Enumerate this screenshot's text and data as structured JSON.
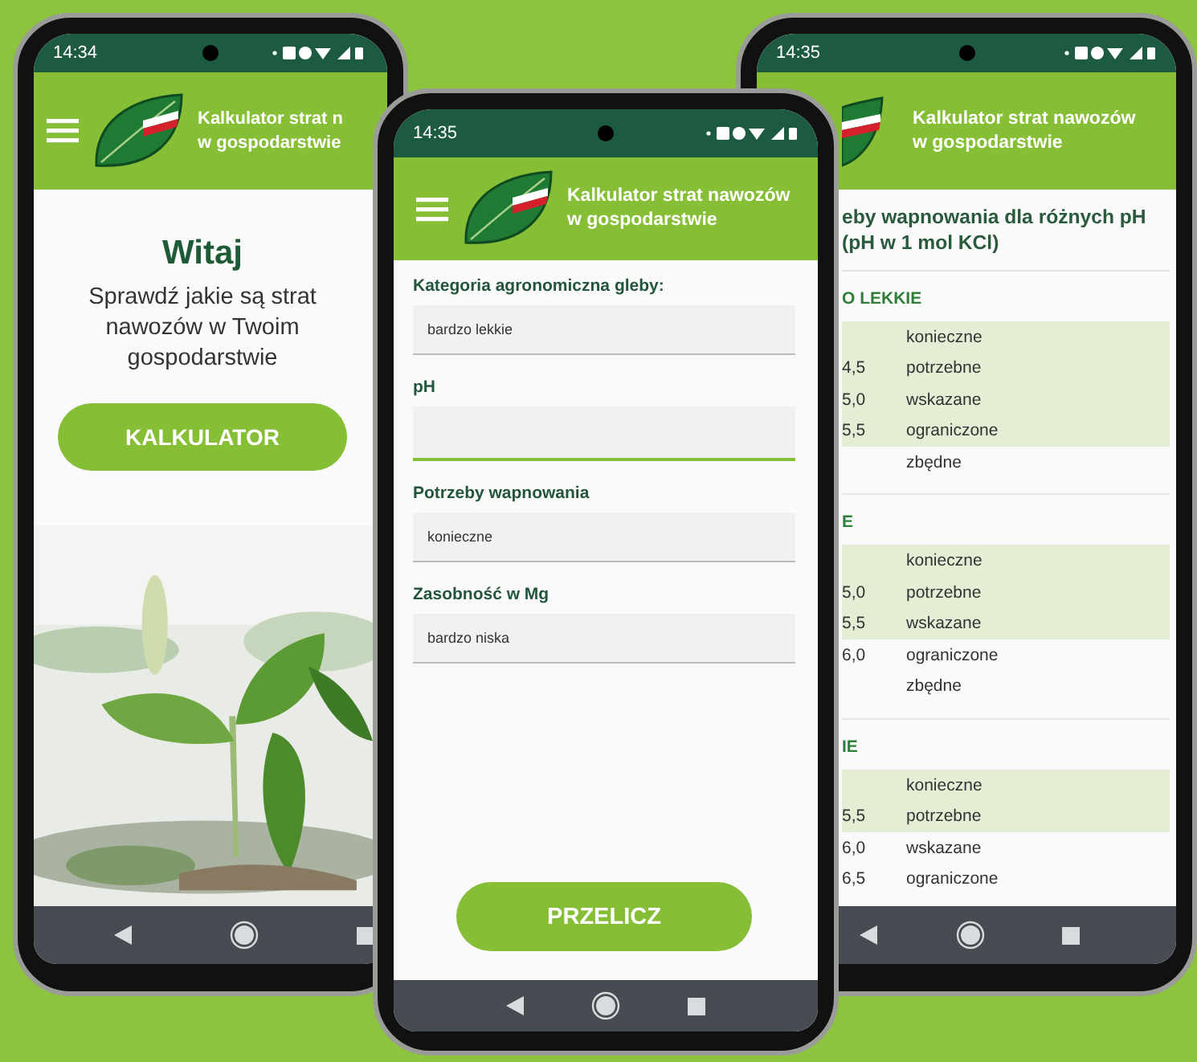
{
  "phones": [
    {
      "kind": "welcome",
      "status_time": "14:34",
      "app_title": [
        "Kalkulator strat n",
        "w gospodarstwie"
      ],
      "heading": "Witaj",
      "message_lines": [
        "Sprawdź jakie są strat",
        "nawozów w Twoim",
        "gospodarstwie"
      ],
      "button": "KALKULATOR"
    },
    {
      "kind": "form",
      "status_time": "14:35",
      "app_title": [
        "Kalkulator strat nawozów",
        "w gospodarstwie"
      ],
      "fields": [
        {
          "label": "Kategoria agronomiczna gleby:",
          "value": "bardzo lekkie",
          "focused": false
        },
        {
          "label": "pH",
          "focused": true
        },
        {
          "label": "Potrzeby wapnowania",
          "value": "konieczne",
          "focused": false
        },
        {
          "label": "Zasobność w Mg",
          "value": "bardzo niska",
          "focused": false
        }
      ],
      "button": "PRZELICZ"
    },
    {
      "kind": "table",
      "status_time": "14:35",
      "app_title": [
        "Kalkulator strat nawozów",
        "w gospodarstwie"
      ],
      "title_lines": [
        "eby wapnowania dla różnych pH",
        "(pH w 1 mol KCl)"
      ],
      "sections": [
        {
          "heading": "O LEKKIE",
          "rows": [
            {
              "need": "konieczne",
              "highlighted": true
            },
            {
              "ph": "4,5",
              "need": "potrzebne",
              "highlighted": true
            },
            {
              "ph": "5,0",
              "need": "wskazane",
              "highlighted": true
            },
            {
              "ph": "5,5",
              "need": "ograniczone",
              "highlighted": true
            },
            {
              "need": "zbędne",
              "highlighted": false
            }
          ]
        },
        {
          "heading": "E",
          "rows": [
            {
              "need": "konieczne",
              "highlighted": true
            },
            {
              "ph": "5,0",
              "need": "potrzebne",
              "highlighted": true
            },
            {
              "ph": "5,5",
              "need": "wskazane",
              "highlighted": true
            },
            {
              "ph": "6,0",
              "need": "ograniczone",
              "highlighted": false
            },
            {
              "need": "zbędne",
              "highlighted": false
            }
          ]
        },
        {
          "heading": "IE",
          "rows": [
            {
              "need": "konieczne",
              "highlighted": true
            },
            {
              "ph": "5,5",
              "need": "potrzebne",
              "highlighted": true
            },
            {
              "ph": "6,0",
              "need": "wskazane",
              "highlighted": false
            },
            {
              "ph": "6,5",
              "need": "ograniczone",
              "highlighted": false
            }
          ]
        }
      ]
    }
  ]
}
